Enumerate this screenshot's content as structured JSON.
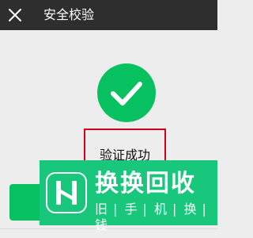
{
  "header": {
    "title": "安全校验",
    "close_icon": "close-icon"
  },
  "verification": {
    "status_text": "验证成功",
    "icon": "check-circle-icon",
    "accent_color": "#07c160",
    "highlight_border_color": "#d0021b"
  },
  "watermark": {
    "title": "换换回收",
    "subtitle_chars": [
      "旧",
      "手",
      "机",
      "换",
      "钱"
    ],
    "background_color": "#18c77b"
  }
}
